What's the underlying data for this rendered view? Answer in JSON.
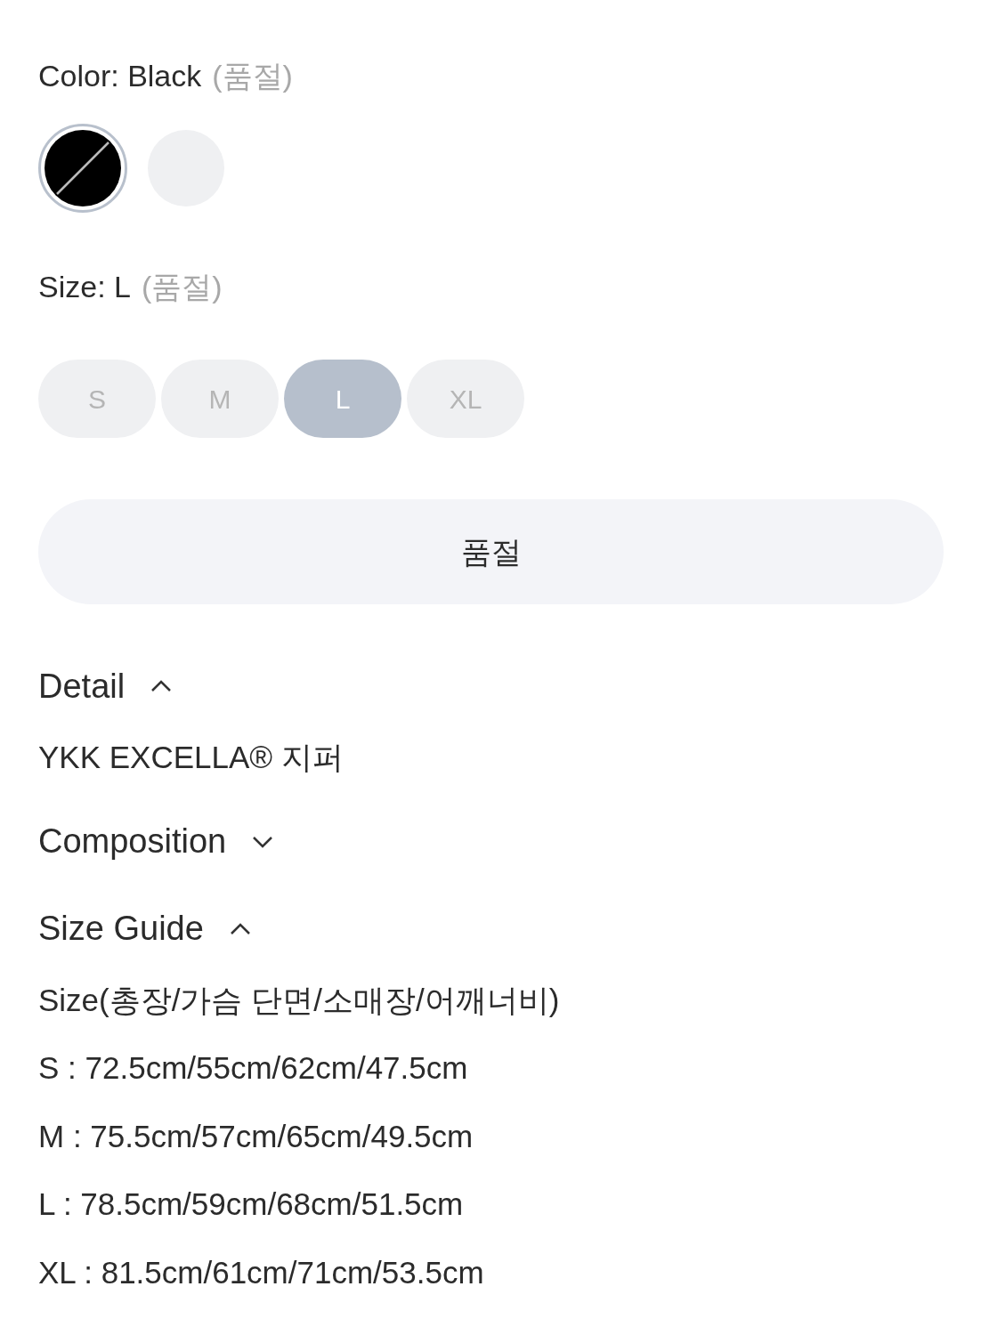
{
  "color_picker": {
    "label": "Color: Black",
    "status": "(품절)",
    "swatches": [
      {
        "color": "#000000",
        "selected": true,
        "sold_out": true
      },
      {
        "color": "#eff0f2",
        "selected": false,
        "sold_out": false
      }
    ]
  },
  "size_picker": {
    "label": "Size: L",
    "status": "(품절)",
    "options": [
      {
        "label": "S",
        "selected": false
      },
      {
        "label": "M",
        "selected": false
      },
      {
        "label": "L",
        "selected": true
      },
      {
        "label": "XL",
        "selected": false
      }
    ]
  },
  "action_button": {
    "label": "품절",
    "disabled": true
  },
  "sections": [
    {
      "title": "Detail",
      "expanded": true,
      "lines": [
        "YKK EXCELLA® 지퍼"
      ]
    },
    {
      "title": "Composition",
      "expanded": false
    },
    {
      "title": "Size Guide",
      "expanded": true,
      "lines": [
        "Size(총장/가슴 단면/소매장/어깨너비)",
        "S : 72.5cm/55cm/62cm/47.5cm",
        "M : 75.5cm/57cm/65cm/49.5cm",
        "L : 78.5cm/59cm/68cm/51.5cm",
        "XL : 81.5cm/61cm/71cm/53.5cm"
      ]
    }
  ]
}
